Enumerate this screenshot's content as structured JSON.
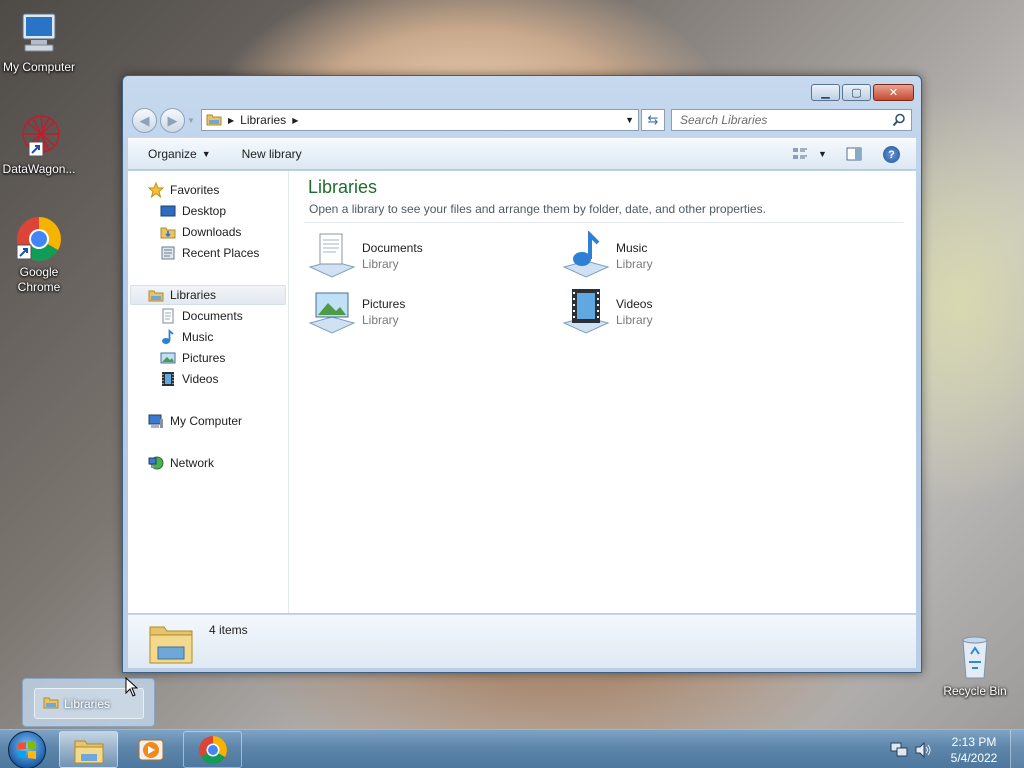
{
  "desktop": {
    "icons": [
      {
        "label": "My Computer"
      },
      {
        "label": "DataWagon..."
      },
      {
        "label": "Google Chrome"
      },
      {
        "label": "Recycle Bin"
      }
    ]
  },
  "window": {
    "address": {
      "path": "Libraries"
    },
    "search": {
      "placeholder": "Search Libraries"
    },
    "toolbar": {
      "organize": "Organize",
      "new_library": "New library"
    },
    "nav": {
      "favorites": "Favorites",
      "fav_items": [
        "Desktop",
        "Downloads",
        "Recent Places"
      ],
      "libraries": "Libraries",
      "lib_items": [
        "Documents",
        "Music",
        "Pictures",
        "Videos"
      ],
      "computer": "My Computer",
      "network": "Network"
    },
    "content": {
      "title": "Libraries",
      "subtitle": "Open a library to see your files and arrange them by folder, date, and other properties.",
      "libraries": [
        {
          "name": "Documents",
          "type": "Library"
        },
        {
          "name": "Music",
          "type": "Library"
        },
        {
          "name": "Pictures",
          "type": "Library"
        },
        {
          "name": "Videos",
          "type": "Library"
        }
      ]
    },
    "status": {
      "count": "4 items"
    }
  },
  "taskbar": {
    "thumbnail_label": "Libraries",
    "clock": {
      "time": "2:13 PM",
      "date": "5/4/2022"
    }
  },
  "colors": {
    "title_green": "#1e6e2d",
    "taskbar": "#5e86ab"
  }
}
